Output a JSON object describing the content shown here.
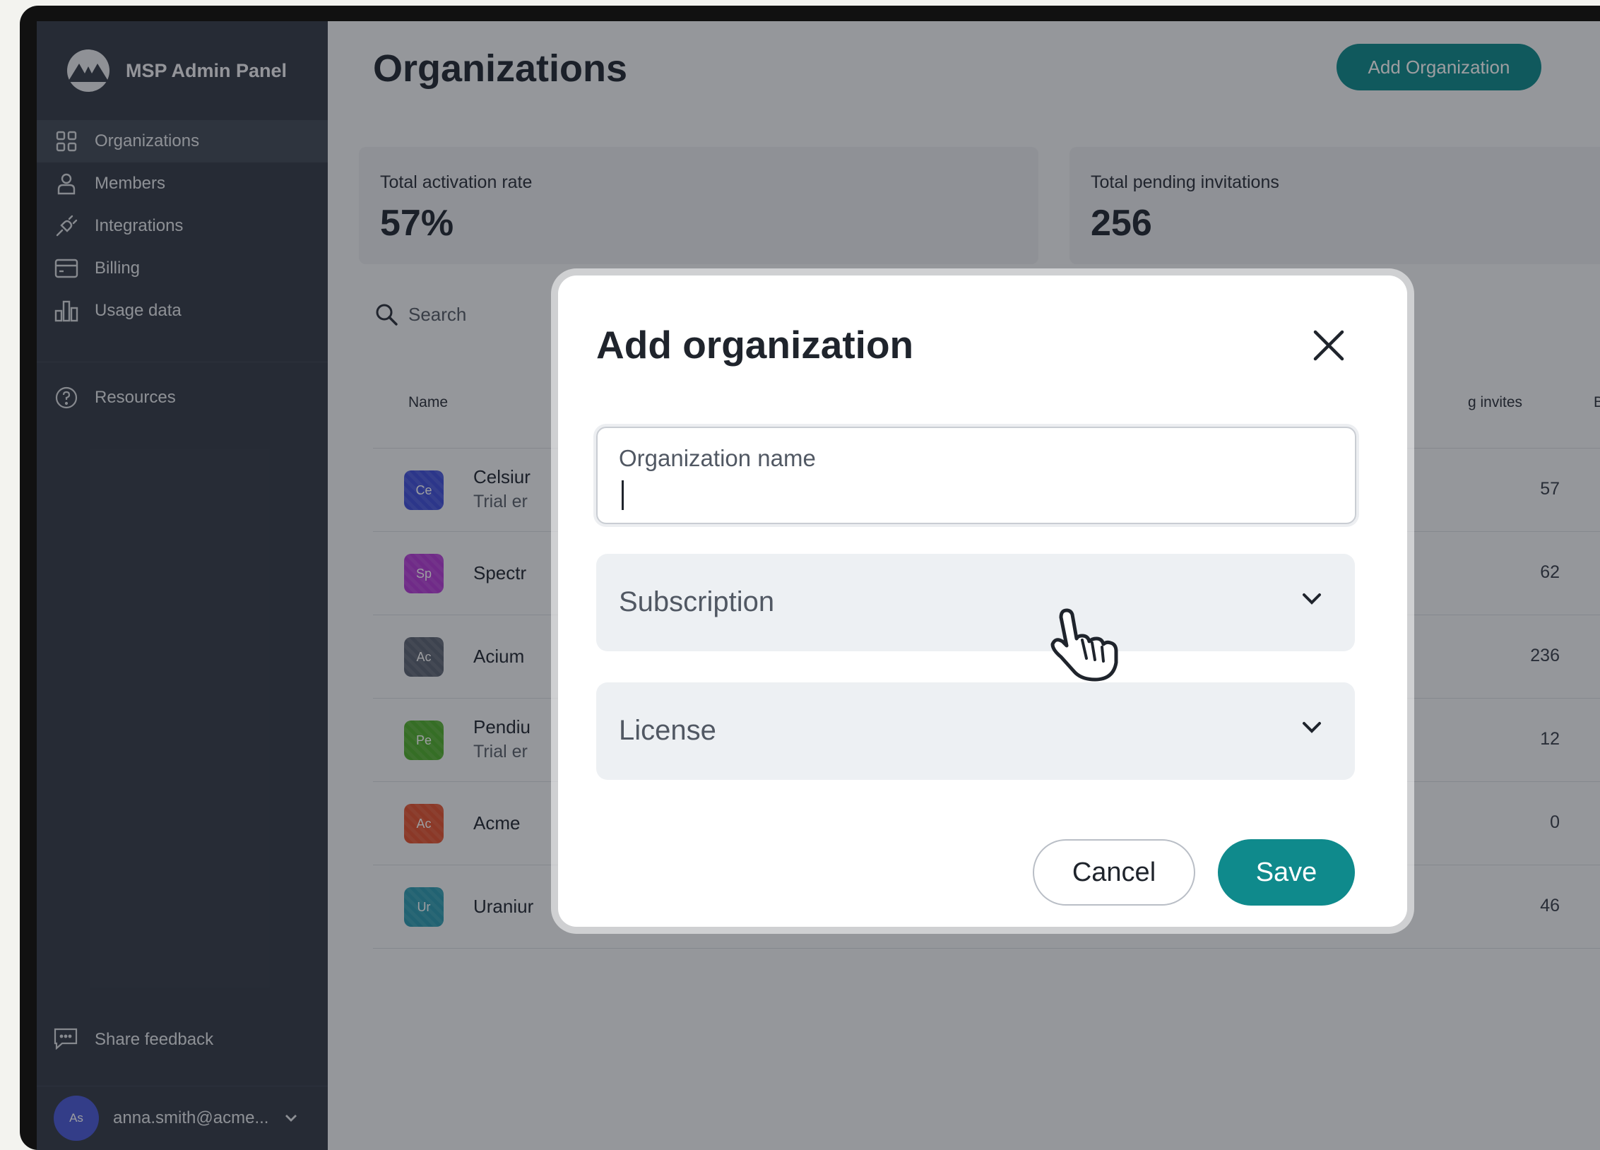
{
  "app": {
    "brand_name": "MSP Admin Panel"
  },
  "sidebar": {
    "items": [
      {
        "label": "Organizations",
        "icon": "grid-icon",
        "active": true
      },
      {
        "label": "Members",
        "icon": "person-icon"
      },
      {
        "label": "Integrations",
        "icon": "plug-icon"
      },
      {
        "label": "Billing",
        "icon": "credit-card-icon"
      },
      {
        "label": "Usage data",
        "icon": "bar-chart-icon"
      }
    ],
    "resources": {
      "label": "Resources",
      "icon": "help-circle-icon"
    },
    "feedback": {
      "label": "Share feedback",
      "icon": "chat-bubble-icon"
    },
    "user": {
      "initials": "As",
      "email": "anna.smith@acme..."
    }
  },
  "main": {
    "title": "Organizations",
    "add_button": "Add Organization",
    "stats": [
      {
        "label": "Total activation rate",
        "value": "57%"
      },
      {
        "label": "Total pending invitations",
        "value": "256"
      }
    ],
    "search_placeholder": "Search",
    "columns": {
      "name": "Name",
      "invites": "g invites",
      "billable": "Billable seat"
    },
    "rows": [
      {
        "badge": "Ce",
        "color": "#3f4fd9",
        "name": "Celsiur",
        "sub": "Trial er",
        "count": "57"
      },
      {
        "badge": "Sp",
        "color": "#b33ad6",
        "name": "Spectr",
        "sub": "",
        "count": "62"
      },
      {
        "badge": "Ac",
        "color": "#5b6272",
        "name": "Acium",
        "sub": "",
        "count": "236"
      },
      {
        "badge": "Pe",
        "color": "#4fae2c",
        "name": "Pendiu",
        "sub": "Trial er",
        "count": "12"
      },
      {
        "badge": "Ac",
        "color": "#e2512f",
        "name": "Acme",
        "sub": "",
        "count": "0"
      },
      {
        "badge": "Ur",
        "color": "#2b9ab0",
        "name": "Uraniur",
        "sub": "",
        "count": "46"
      }
    ]
  },
  "modal": {
    "title": "Add organization",
    "name_field_label": "Organization name",
    "name_field_value": "",
    "subscription_label": "Subscription",
    "license_label": "License",
    "cancel": "Cancel",
    "save": "Save"
  },
  "colors": {
    "accent": "#0f8a8c",
    "sidebar_bg": "#353c48"
  }
}
